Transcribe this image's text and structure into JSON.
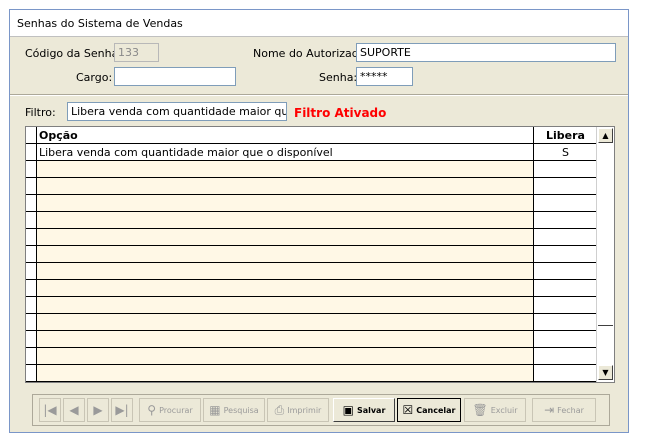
{
  "window": {
    "title": "Senhas do Sistema de Vendas"
  },
  "form": {
    "codigo_label": "Código da Senha:",
    "codigo_value": "133",
    "nome_label": "Nome do Autorizado:",
    "nome_value": "SUPORTE",
    "cargo_label": "Cargo:",
    "cargo_value": "",
    "senha_label": "Senha:",
    "senha_value": "*****"
  },
  "filter": {
    "label": "Filtro:",
    "value": "Libera venda com quantidade maior que o dis",
    "status": "Filtro Ativado"
  },
  "grid": {
    "columns": [
      "Opção",
      "Libera"
    ],
    "rows": [
      {
        "opcao": "Libera venda com quantidade maior que o disponível",
        "libera": "S"
      },
      {
        "opcao": "",
        "libera": ""
      },
      {
        "opcao": "",
        "libera": ""
      },
      {
        "opcao": "",
        "libera": ""
      },
      {
        "opcao": "",
        "libera": ""
      },
      {
        "opcao": "",
        "libera": ""
      },
      {
        "opcao": "",
        "libera": ""
      },
      {
        "opcao": "",
        "libera": ""
      },
      {
        "opcao": "",
        "libera": ""
      },
      {
        "opcao": "",
        "libera": ""
      },
      {
        "opcao": "",
        "libera": ""
      },
      {
        "opcao": "",
        "libera": ""
      },
      {
        "opcao": "",
        "libera": ""
      },
      {
        "opcao": "",
        "libera": ""
      }
    ],
    "empty_row_color": "#fff8e6"
  },
  "toolbar": {
    "procurar": "Procurar",
    "pesquisa": "Pesquisa",
    "imprimir": "Imprimir",
    "salvar": "Salvar",
    "cancelar": "Cancelar",
    "excluir": "Excluir",
    "fechar": "Fechar"
  }
}
